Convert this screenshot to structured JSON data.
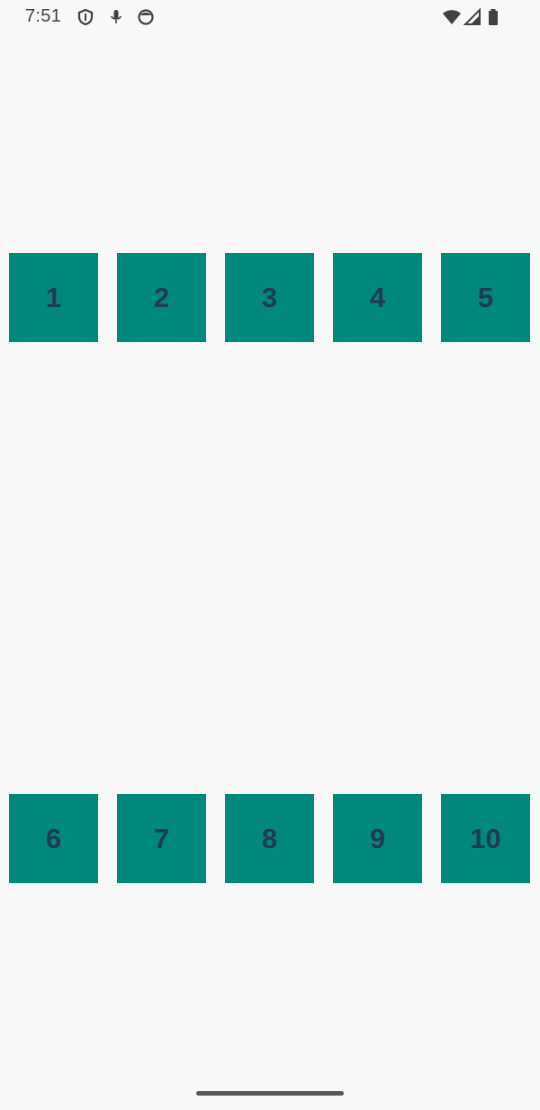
{
  "status_bar": {
    "time": "7:51",
    "icons": [
      "shield-icon",
      "microphone-icon",
      "face-icon",
      "wifi-icon",
      "signal-icon",
      "battery-icon"
    ]
  },
  "colors": {
    "tile_background": "#00897b",
    "tile_text": "#213a55",
    "page_background": "#f8f8f9"
  },
  "grid": {
    "row_1": [
      "1",
      "2",
      "3",
      "4",
      "5"
    ],
    "row_2": [
      "6",
      "7",
      "8",
      "9",
      "10"
    ]
  }
}
